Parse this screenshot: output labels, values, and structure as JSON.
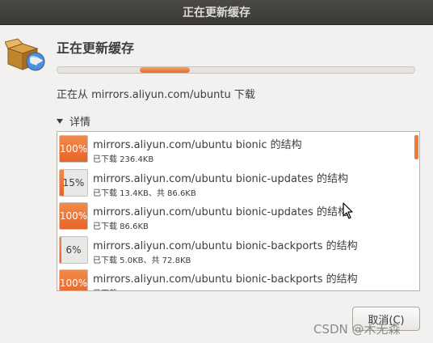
{
  "window": {
    "title": "正在更新缓存"
  },
  "header": {
    "heading": "正在更新缓存"
  },
  "progress": {
    "mode": "indeterminate",
    "pulse_start": 0.23,
    "pulse_width": 0.14,
    "accent": "#e96a2a"
  },
  "status": {
    "text": "正在从 mirrors.aliyun.com/ubuntu 下载"
  },
  "details": {
    "label": "详情",
    "expanded": true
  },
  "downloads": [
    {
      "percent_label": "100%",
      "progress": 1.0,
      "title": "mirrors.aliyun.com/ubuntu bionic 的结构",
      "detail": "已下载 236.4KB"
    },
    {
      "percent_label": "15%",
      "progress": 0.15,
      "title": "mirrors.aliyun.com/ubuntu bionic-updates 的结构",
      "detail": "已下载 13.4KB、共 86.6KB"
    },
    {
      "percent_label": "100%",
      "progress": 1.0,
      "title": "mirrors.aliyun.com/ubuntu bionic-updates 的结构",
      "detail": "已下载 86.6KB"
    },
    {
      "percent_label": "6%",
      "progress": 0.06,
      "title": "mirrors.aliyun.com/ubuntu bionic-backports 的结构",
      "detail": "已下载 5.0KB、共 72.8KB"
    },
    {
      "percent_label": "100%",
      "progress": 1.0,
      "title": "mirrors.aliyun.com/ubuntu bionic-backports 的结构",
      "detail": "已下载"
    }
  ],
  "buttons": {
    "cancel": "取消(C)"
  },
  "watermark": "CSDN @木无森",
  "icons": {
    "app": "package-globe-icon",
    "expander": "triangle-down-icon",
    "cursor": "mouse-pointer-icon"
  }
}
